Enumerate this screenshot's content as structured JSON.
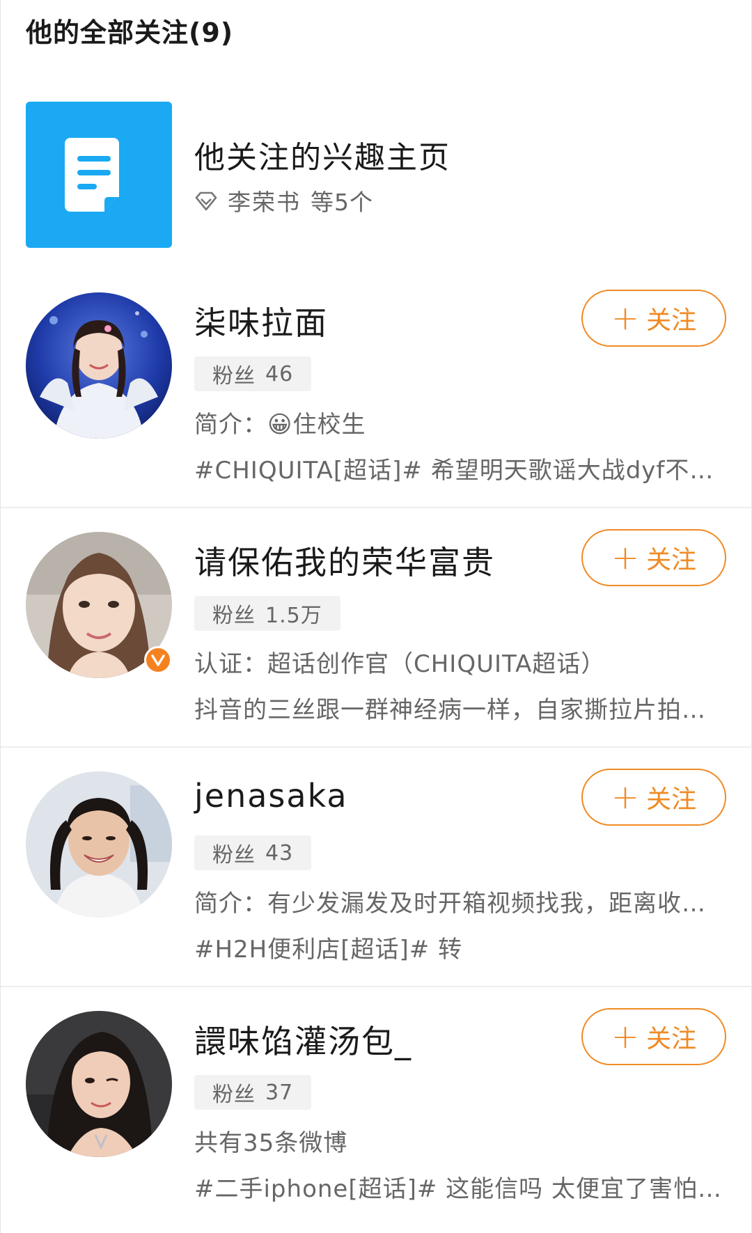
{
  "header": {
    "title": "他的全部关注(9)"
  },
  "interest": {
    "title": "他关注的兴趣主页",
    "names": "李荣书",
    "count": "等5个",
    "icon": "document-icon",
    "icon_color": "#1aa9f2"
  },
  "users": [
    {
      "name": "柒味拉面",
      "follow_label": "关注",
      "fans_label": "粉丝",
      "fans_count": "46",
      "bio": "简介：😀住校生",
      "latest": "#CHIQUITA[超话]# 希望明天歌谣大战dyf不…",
      "verified": false
    },
    {
      "name": "请保佑我的荣华富贵",
      "follow_label": "关注",
      "fans_label": "粉丝",
      "fans_count": "1.5万",
      "bio": "认证：超话创作官（CHIQUITA超话）",
      "latest": "抖音的三丝跟一群神经病一样，自家撕拉片拍…",
      "verified": true
    },
    {
      "name": "jenasaka",
      "follow_label": "关注",
      "fans_label": "粉丝",
      "fans_count": "43",
      "bio": "简介：有少发漏发及时开箱视频找我，距离收…",
      "latest": "#H2H便利店[超话]# 转",
      "verified": false
    },
    {
      "name": "譞味馅灌汤包_",
      "follow_label": "关注",
      "fans_label": "粉丝",
      "fans_count": "37",
      "bio": "共有35条微博",
      "latest": "#二手iphone[超话]# 这能信吗 太便宜了害怕…",
      "verified": false
    }
  ],
  "colors": {
    "accent": "#f08a24",
    "verified": "#f5821f"
  }
}
